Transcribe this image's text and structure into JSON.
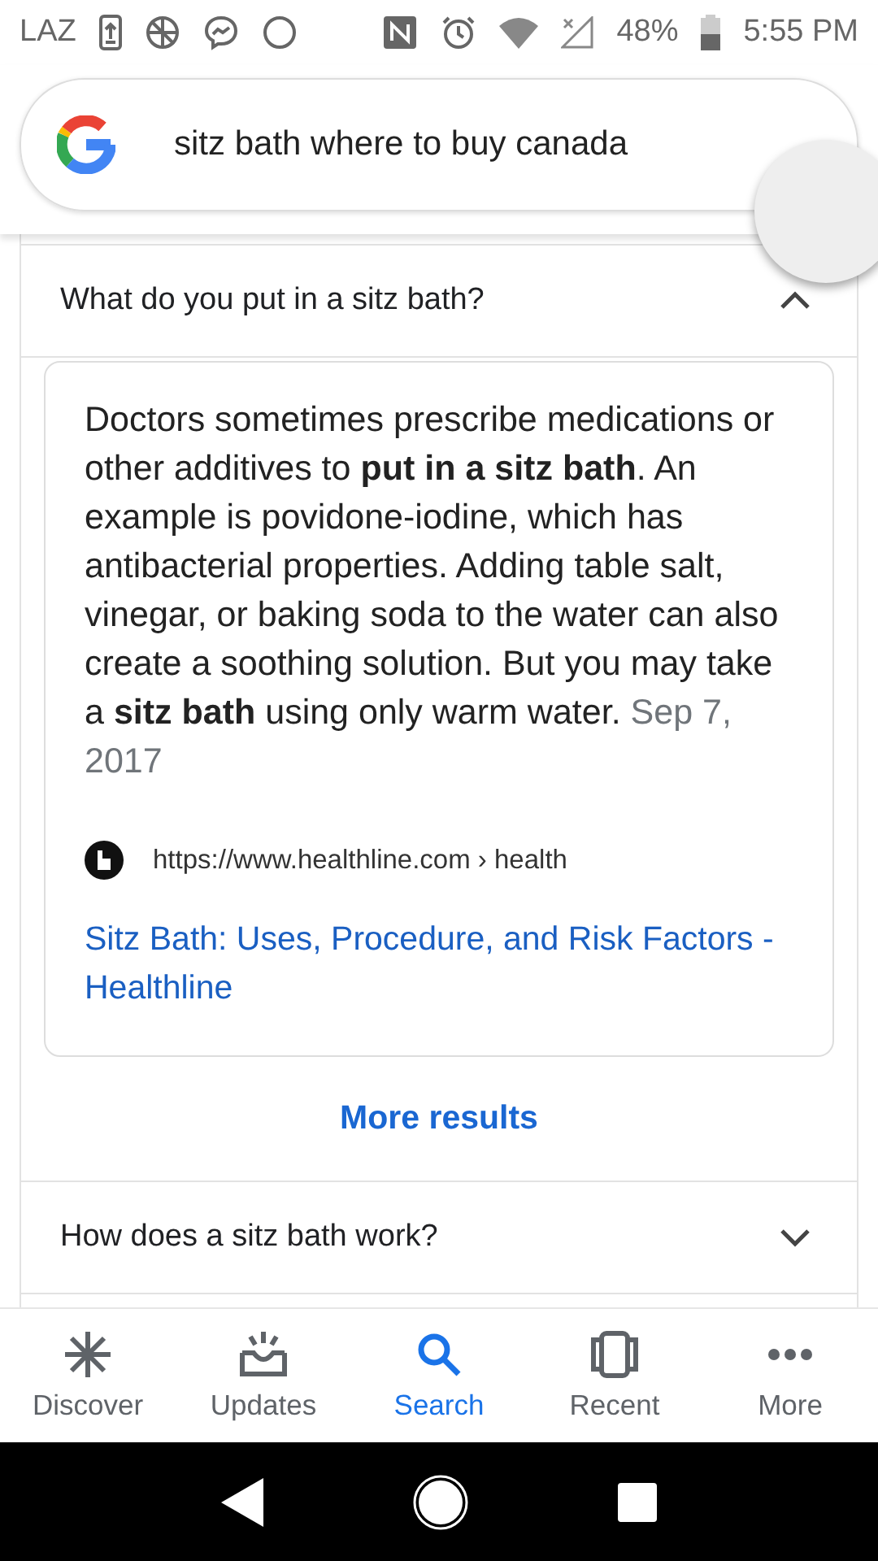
{
  "status_bar": {
    "carrier": "LAZ",
    "battery": "48%",
    "time": "5:55 PM"
  },
  "search": {
    "value": "sitz bath where to buy canada"
  },
  "questions": [
    {
      "question": "What do you put in a sitz bath?",
      "expanded": true,
      "answer": "Doctors sometimes prescribe medications or other additives to **put in a sitz bath**. An example is povidone-iodine, which has antibacterial properties. Adding table salt, vinegar, or baking soda to the water can also create a soothing solution. But you may take a **sitz bath** using only warm water.",
      "date": "Sep 7, 2017",
      "url": "https://www.healthline.com › health",
      "link": "Sitz Bath: Uses, Procedure, and Risk Factors - Healthline",
      "more": "More results"
    },
    {
      "question": "How does a sitz bath work?",
      "expanded": false
    }
  ],
  "nav": [
    {
      "label": "Discover",
      "selected": false
    },
    {
      "label": "Updates",
      "selected": false
    },
    {
      "label": "Search",
      "selected": true
    },
    {
      "label": "Recent",
      "selected": false
    },
    {
      "label": "More",
      "selected": false
    }
  ]
}
